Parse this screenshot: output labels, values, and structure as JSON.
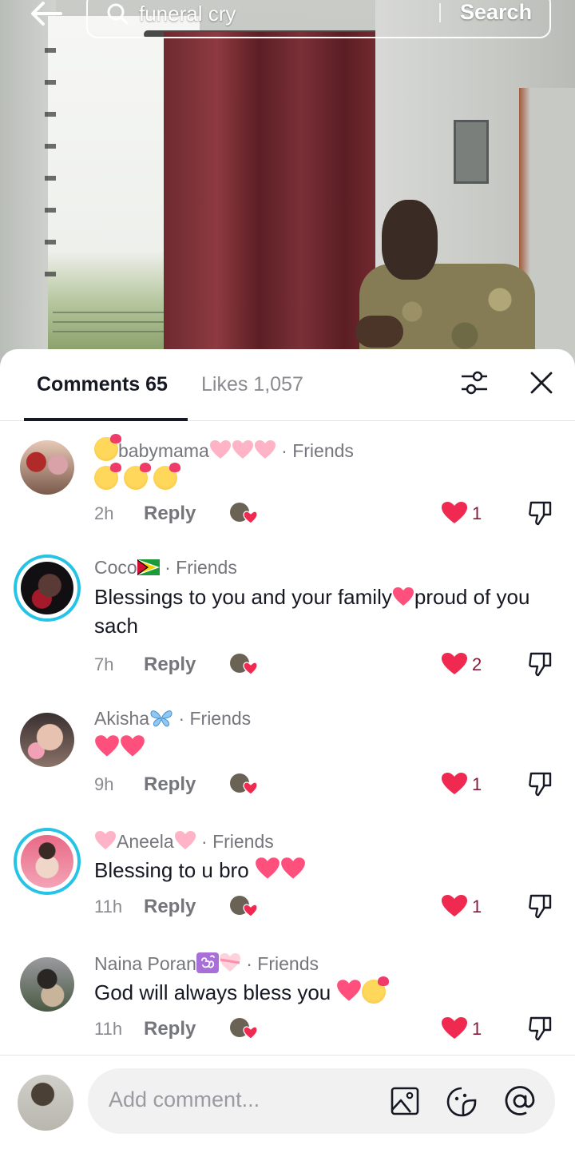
{
  "search": {
    "query": "funeral cry",
    "button_label": "Search"
  },
  "tabs": {
    "comments": "Comments 65",
    "likes": "Likes 1,057"
  },
  "comments": [
    {
      "name": "babymama",
      "friends": "· Friends",
      "text": "",
      "time": "2h",
      "reply": "Reply",
      "likes": "1"
    },
    {
      "name": "Coco",
      "friends": "· Friends",
      "text_a": "Blessings to you and your family",
      "text_b": "proud of you sach",
      "time": "7h",
      "reply": "Reply",
      "likes": "2"
    },
    {
      "name": "Akisha",
      "friends": "· Friends",
      "text": "",
      "time": "9h",
      "reply": "Reply",
      "likes": "1"
    },
    {
      "name": "Aneela",
      "friends": "· Friends",
      "text": "Blessing to u bro ",
      "time": "11h",
      "reply": "Reply",
      "likes": "1"
    },
    {
      "name": "Naina Poran",
      "friends": "· Friends",
      "text": "God will always bless you ",
      "time": "11h",
      "reply": "Reply",
      "likes": "1"
    }
  ],
  "input": {
    "placeholder": "Add comment..."
  },
  "colors": {
    "like_red": "#ef2950",
    "ring_blue": "#25c4e6",
    "text_dark": "#161823",
    "text_gray": "#75767c"
  }
}
